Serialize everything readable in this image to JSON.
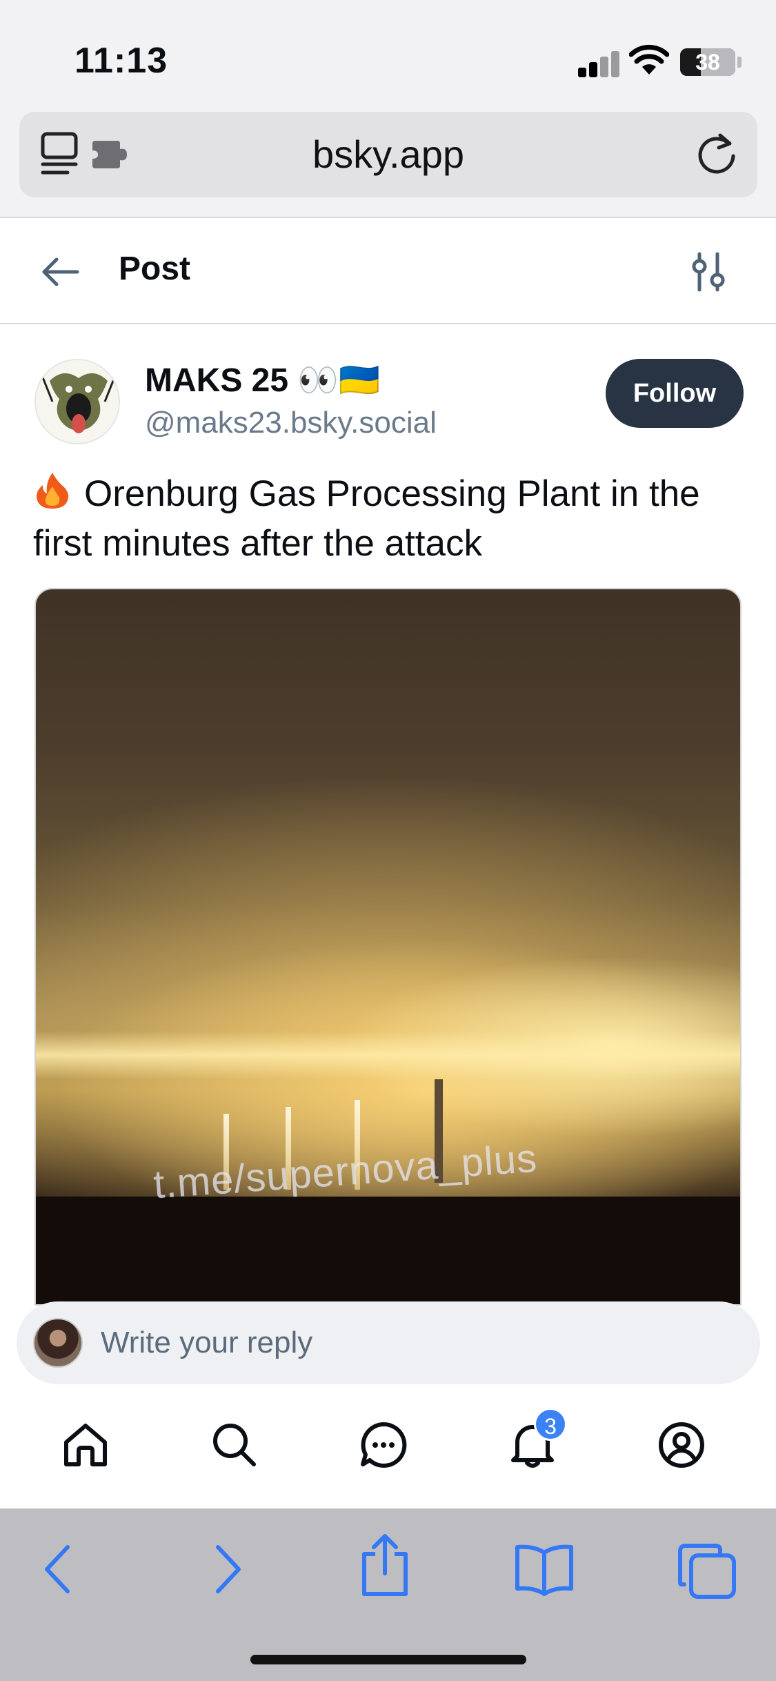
{
  "status_bar": {
    "time": "11:13",
    "battery": "38",
    "battery_level_percent": 38
  },
  "address_bar": {
    "url": "bsky.app"
  },
  "header": {
    "title": "Post"
  },
  "post": {
    "author_name": "MAKS 25 👀🇺🇦",
    "author_handle": "@maks23.bsky.social",
    "follow_label": "Follow",
    "text": "Orenburg Gas Processing Plant in the first minutes after the attack",
    "media_watermark": "t.me/supernova_plus"
  },
  "reply": {
    "placeholder": "Write your reply"
  },
  "bottom_nav": {
    "items": [
      "home-icon",
      "search-icon",
      "chat-icon",
      "bell-icon",
      "profile-icon"
    ],
    "notification_count": "3"
  },
  "colors": {
    "accent": "#3b82f6",
    "follow_bg": "#283343",
    "safari_blue": "#3478f6"
  }
}
